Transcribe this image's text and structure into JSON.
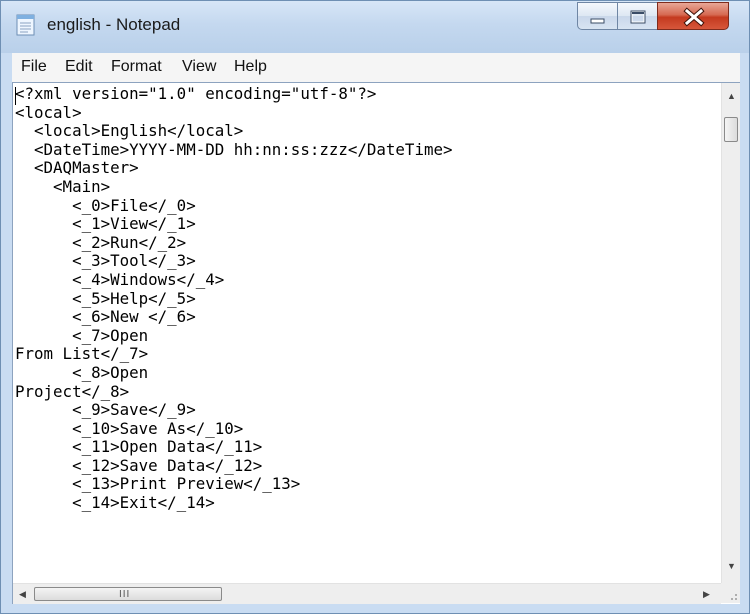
{
  "window": {
    "title": "english - Notepad",
    "icon": "notepad-icon",
    "controls": [
      "minimize-icon",
      "maximize-icon",
      "close-icon"
    ],
    "close_color": "#c7432a"
  },
  "menu": {
    "items": [
      {
        "label": "File"
      },
      {
        "label": "Edit"
      },
      {
        "label": "Format"
      },
      {
        "label": "View"
      },
      {
        "label": "Help"
      }
    ]
  },
  "editor": {
    "lines": [
      "<?xml version=\"1.0\" encoding=\"utf-8\"?>",
      "<local>",
      "  <local>English</local>",
      "  <DateTime>YYYY-MM-DD hh:nn:ss:zzz</DateTime>",
      "  <DAQMaster>",
      "    <Main>",
      "      <_0>File</_0>",
      "      <_1>View</_1>",
      "      <_2>Run</_2>",
      "      <_3>Tool</_3>",
      "      <_4>Windows</_4>",
      "      <_5>Help</_5>",
      "      <_6>New </_6>",
      "      <_7>Open",
      "From List</_7>",
      "      <_8>Open",
      "Project</_8>",
      "      <_9>Save</_9>",
      "      <_10>Save As</_10>",
      "      <_11>Open Data</_11>",
      "      <_12>Save Data</_12>",
      "      <_13>Print Preview</_13>",
      "      <_14>Exit</_14>"
    ]
  },
  "scrollbars": {
    "vertical": {
      "up_icon": "scroll-up-arrow-icon",
      "down_icon": "scroll-down-arrow-icon"
    },
    "horizontal": {
      "left_icon": "scroll-left-arrow-icon",
      "right_icon": "scroll-right-arrow-icon",
      "grip": "III"
    }
  }
}
